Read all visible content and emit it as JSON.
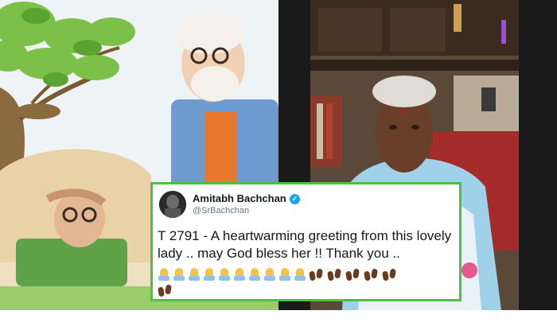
{
  "tweet": {
    "author_name": "Amitabh Bachchan",
    "author_handle": "@SrBachchan",
    "text": "T 2791 - A heartwarming greeting from this lovely lady .. may God bless her !! Thank you ..",
    "emoji_rows": [
      {
        "pray_count": 10,
        "footprint_count": 5
      },
      {
        "pray_count": 0,
        "footprint_count": 1
      }
    ]
  },
  "colors": {
    "tweet_border": "#48c43f",
    "verified_badge": "#1da1f2",
    "handle_text": "#657786",
    "name_text": "#14171a"
  }
}
